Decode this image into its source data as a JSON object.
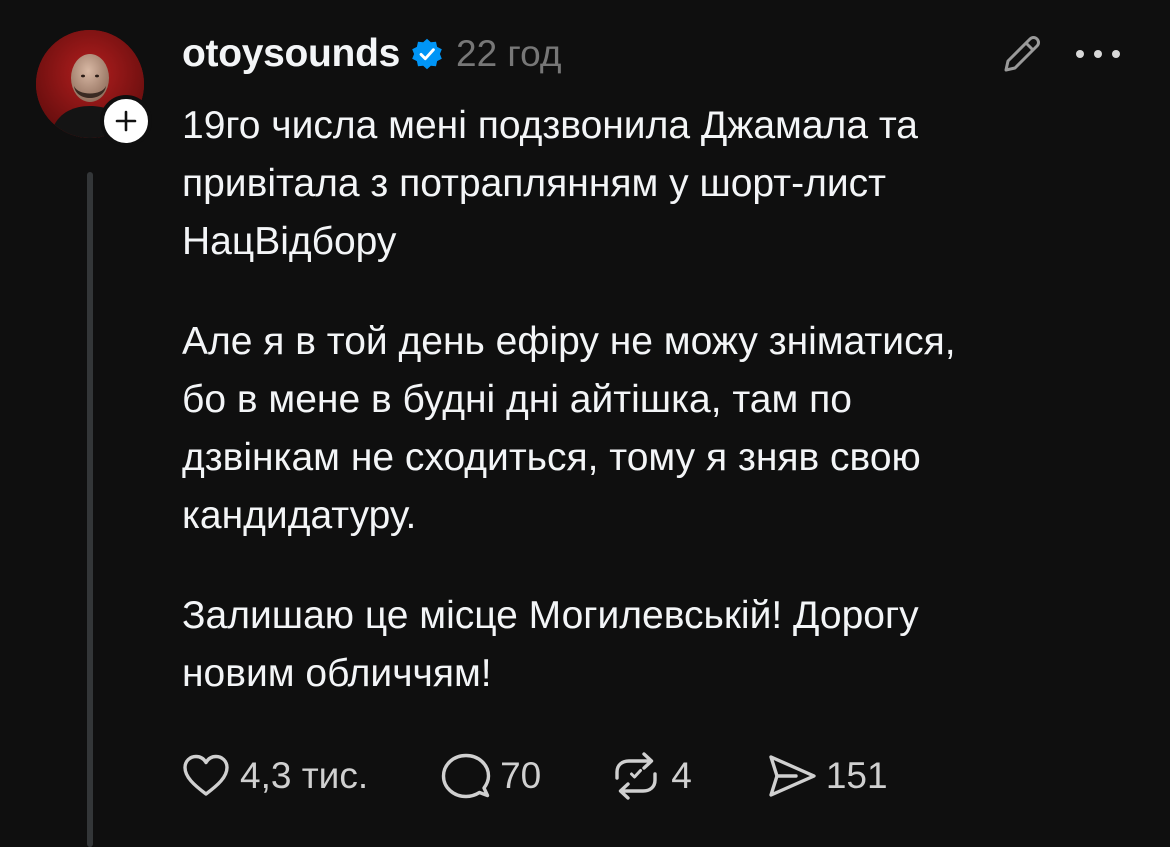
{
  "post": {
    "username": "otoysounds",
    "timestamp": "22 год",
    "paragraphs": [
      "19го числа мені подзвонила Джамала та\nпривітала з потраплянням у шорт-лист\nНацВідбору",
      "Але я в той день ефіру не можу зніматися,\nбо в мене в будні дні айтішка, там по\nдзвінкам не сходиться, тому я зняв свою\nкандидатуру.",
      "Залишаю це місце Могилевській! Дорогу\nновим обличчям!"
    ],
    "actions": {
      "likes": "4,3 тис.",
      "replies": "70",
      "reposts": "4",
      "shares": "151"
    }
  },
  "icons": {
    "verified": "verified-badge-icon",
    "edit": "pencil-icon",
    "more": "more-horizontal-icon",
    "follow": "plus-icon",
    "like": "heart-icon",
    "reply": "comment-icon",
    "repost": "repost-icon",
    "share": "send-icon"
  },
  "colors": {
    "background": "#0f0f0f",
    "text": "#f3f5f7",
    "secondary_text": "#777777",
    "verified": "#0095f6",
    "avatar_bg": "#8a1414",
    "thread_line": "#333638"
  }
}
